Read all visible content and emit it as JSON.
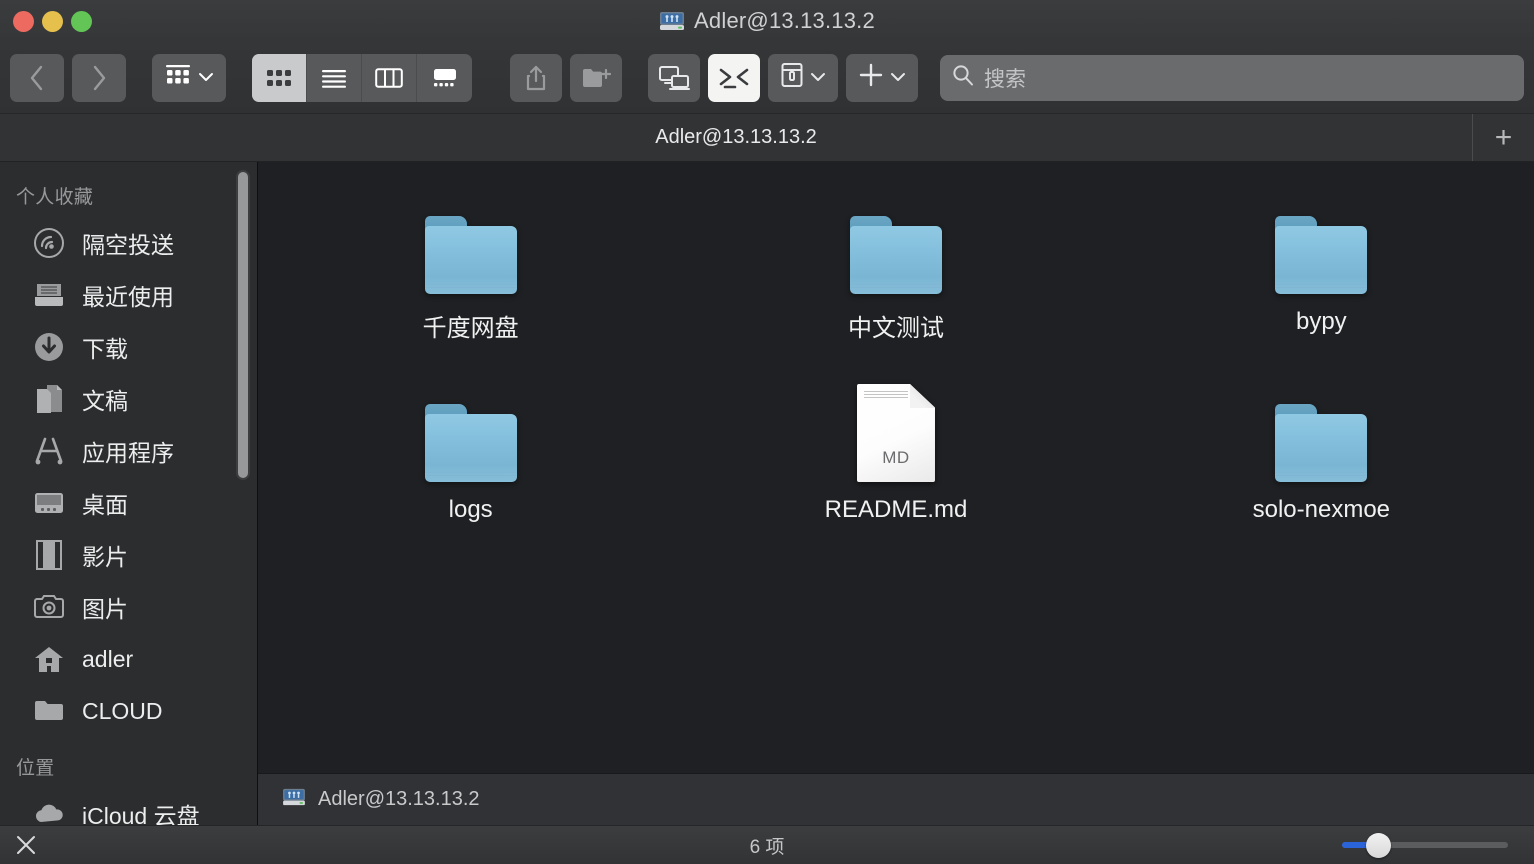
{
  "window": {
    "title": "Adler@13.13.13.2",
    "title_icon": "network-drive-icon",
    "traffic_lights": [
      "close-button",
      "minimize-button",
      "zoom-button"
    ]
  },
  "toolbar": {
    "back_label": "‹",
    "forward_label": "›",
    "group_view_icon": "grid-group-icon",
    "view_modes": [
      {
        "name": "icon-view",
        "icon": "grid-icon",
        "active": true
      },
      {
        "name": "list-view",
        "icon": "list-icon",
        "active": false
      },
      {
        "name": "column-view",
        "icon": "columns-icon",
        "active": false
      },
      {
        "name": "gallery-view",
        "icon": "gallery-icon",
        "active": false
      }
    ],
    "share_icon": "share-icon",
    "new_folder_icon": "new-folder-icon",
    "screen_share_icon": "screen-sharing-icon",
    "terminal_icon": "terminal-icon",
    "terminal_active": true,
    "archive_icon": "archive-box-icon",
    "add_icon": "plus-icon",
    "chevron_icon": "chevron-down-icon"
  },
  "search": {
    "placeholder": "搜索",
    "value": "",
    "icon": "search-icon"
  },
  "tabbar": {
    "tabs": [
      {
        "label": "Adler@13.13.13.2",
        "active": true
      }
    ],
    "add_tab_label": "+"
  },
  "sidebar": {
    "sections": [
      {
        "header": "个人收藏",
        "items": [
          {
            "label": "隔空投送",
            "icon": "airdrop-icon"
          },
          {
            "label": "最近使用",
            "icon": "recents-icon"
          },
          {
            "label": "下载",
            "icon": "downloads-icon"
          },
          {
            "label": "文稿",
            "icon": "documents-icon"
          },
          {
            "label": "应用程序",
            "icon": "applications-icon"
          },
          {
            "label": "桌面",
            "icon": "desktop-icon"
          },
          {
            "label": "影片",
            "icon": "movies-icon"
          },
          {
            "label": "图片",
            "icon": "pictures-icon"
          },
          {
            "label": "adler",
            "icon": "home-icon"
          },
          {
            "label": "CLOUD",
            "icon": "folder-icon"
          }
        ]
      },
      {
        "header": "位置",
        "items": [
          {
            "label": "iCloud 云盘",
            "icon": "icloud-icon"
          }
        ]
      }
    ]
  },
  "files": [
    {
      "name": "千度网盘",
      "type": "folder"
    },
    {
      "name": "中文测试",
      "type": "folder"
    },
    {
      "name": "bypy",
      "type": "folder"
    },
    {
      "name": "logs",
      "type": "folder"
    },
    {
      "name": "README.md",
      "type": "document",
      "extension": "MD"
    },
    {
      "name": "solo-nexmoe",
      "type": "folder"
    }
  ],
  "pathbar": {
    "icon": "network-drive-icon",
    "text": "Adler@13.13.13.2"
  },
  "statusbar": {
    "tool_icon": "connect-icon",
    "item_count": "6 项",
    "zoom_value": 18
  },
  "colors": {
    "accent": "#2b63d9",
    "content_bg": "#1e2023",
    "sidebar_bg": "#2b2d2f",
    "chrome_bg": "#343638",
    "folder_blue": "#84c0dd"
  }
}
